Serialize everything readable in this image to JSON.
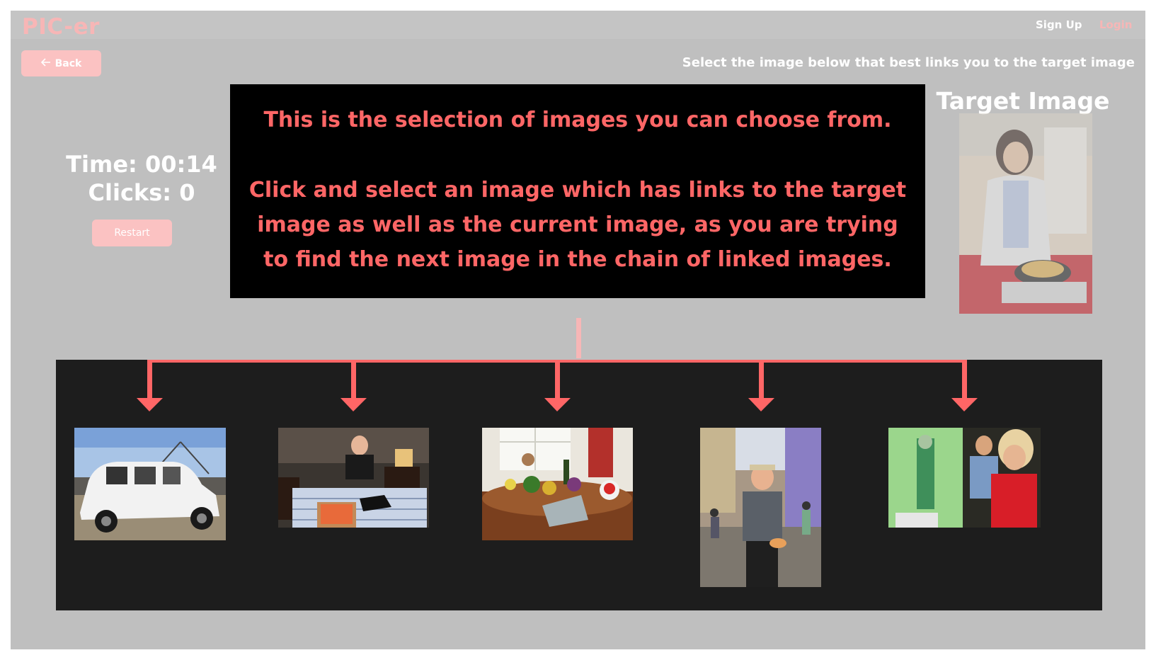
{
  "app": {
    "logo": "PIC-er"
  },
  "nav": {
    "signup_label": "Sign Up",
    "login_label": "Login"
  },
  "toolbar": {
    "back_label": "Back",
    "back_icon": "arrow-left-icon"
  },
  "instruction": "Select the image below that best links you to the target image",
  "stats": {
    "time_text": "Time: 00:14",
    "clicks_text": "Clicks: 0"
  },
  "restart_label": "Restart",
  "tutorial": {
    "line1": "This is the selection of images you can choose from.",
    "line2": "Click and select an image which has links to the target image as well as the current image, as you are trying to find the next image in the chain of linked images."
  },
  "target": {
    "title": "Target Image"
  },
  "colors": {
    "accent_pink": "#fbc2c2",
    "tutorial_text": "#ff6666",
    "arrow_red": "#ff6666",
    "background_gray": "#bfbfbf",
    "gallery_dark": "#1d1d1d"
  },
  "choices": [
    {
      "icon": "car-photo"
    },
    {
      "icon": "man-on-bed-photo"
    },
    {
      "icon": "kitchen-table-photo"
    },
    {
      "icon": "man-in-street-photo"
    },
    {
      "icon": "presentation-photo"
    }
  ]
}
